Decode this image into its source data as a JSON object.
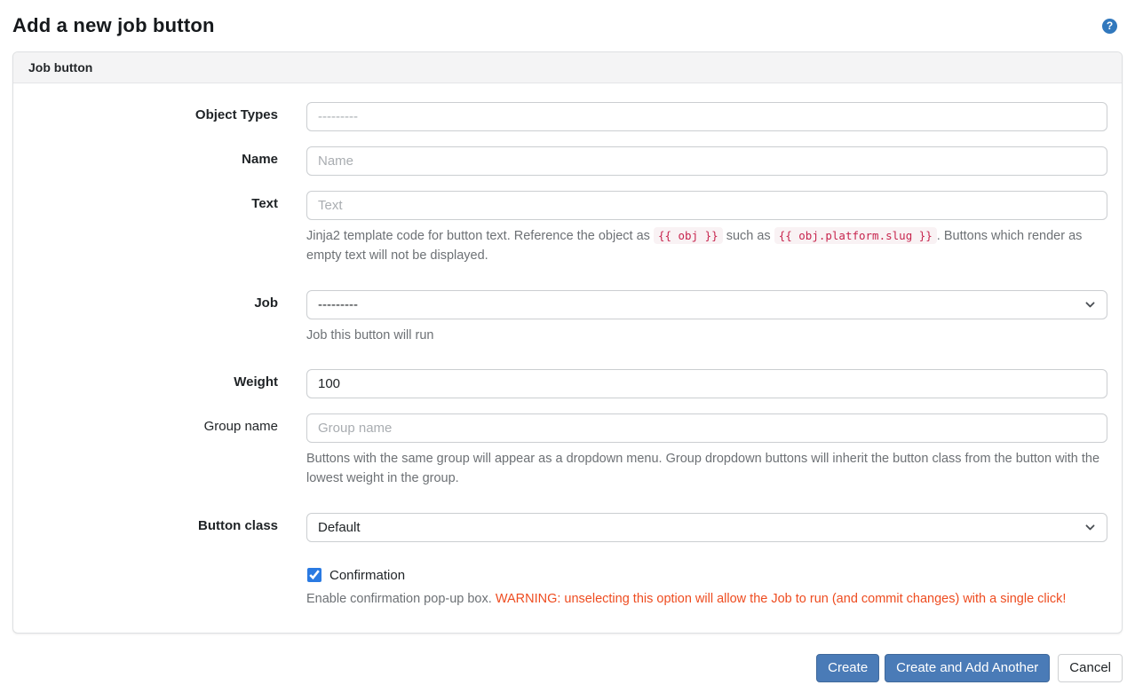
{
  "page": {
    "title": "Add a new job button"
  },
  "panel": {
    "header": "Job button"
  },
  "form": {
    "object_types": {
      "label": "Object Types",
      "placeholder": "---------"
    },
    "name": {
      "label": "Name",
      "placeholder": "Name"
    },
    "text": {
      "label": "Text",
      "placeholder": "Text",
      "help_part1": "Jinja2 template code for button text. Reference the object as ",
      "help_code1": "{{ obj }}",
      "help_part2": " such as ",
      "help_code2": "{{ obj.platform.slug }}",
      "help_part3": ". Buttons which render as empty text will not be displayed."
    },
    "job": {
      "label": "Job",
      "selected_value": "---------",
      "help": "Job this button will run"
    },
    "weight": {
      "label": "Weight",
      "value": "100"
    },
    "group_name": {
      "label": "Group name",
      "placeholder": "Group name",
      "help": "Buttons with the same group will appear as a dropdown menu. Group dropdown buttons will inherit the button class from the button with the lowest weight in the group."
    },
    "button_class": {
      "label": "Button class",
      "selected_value": "Default"
    },
    "confirmation": {
      "label": "Confirmation",
      "checked": true,
      "help_part1": "Enable confirmation pop-up box. ",
      "help_warning": "WARNING: unselecting this option will allow the Job to run (and commit changes) with a single click!"
    }
  },
  "footer": {
    "create": "Create",
    "create_and_add": "Create and Add Another",
    "cancel": "Cancel"
  },
  "icons": {
    "help": "question-mark-icon",
    "select_chevron": "chevron-down-icon"
  },
  "colors": {
    "primary_button": "#4a7bb7",
    "help_icon_blue": "#3178bd",
    "checkbox_blue": "#2a7ae2",
    "warning_text": "#ee4c20",
    "code_text": "#c7254e",
    "code_background": "#f9f2f4",
    "panel_header_background": "#f4f4f5",
    "help_text_gray": "#6d7175"
  }
}
